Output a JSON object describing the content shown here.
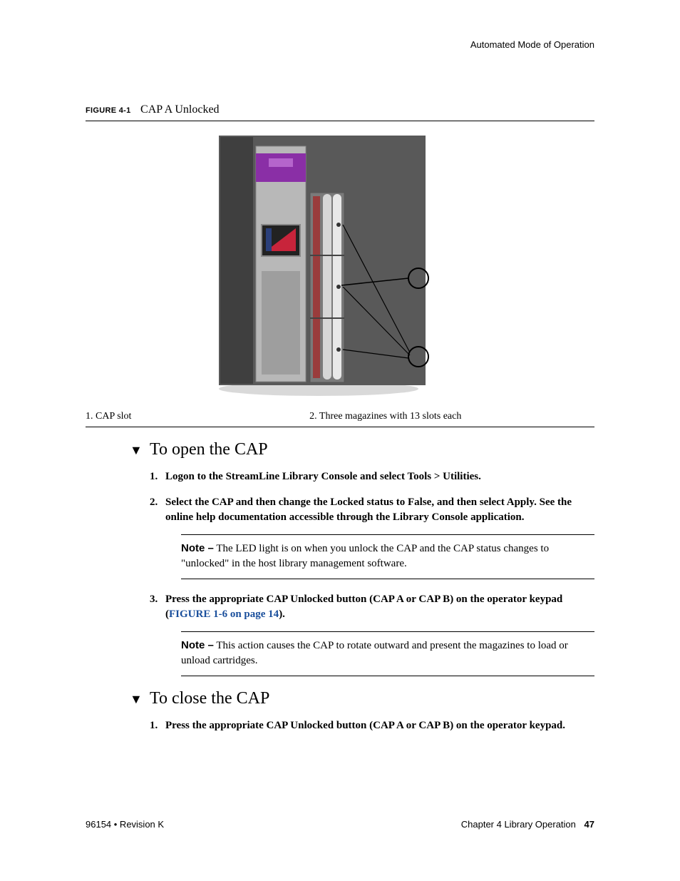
{
  "header": {
    "section": "Automated Mode of Operation"
  },
  "figure": {
    "label": "FIGURE 4-1",
    "title": "CAP A Unlocked",
    "legend": {
      "left": "1. CAP slot",
      "right": "2. Three magazines with 13 slots each"
    }
  },
  "sections": {
    "open": {
      "title": "To open the CAP",
      "steps": [
        "Logon to the StreamLine Library Console and select Tools > Utilities.",
        "Select the CAP and then change the Locked status to False, and then select Apply. See the online help documentation accessible through the Library Console application.",
        "Press the appropriate CAP Unlocked button (CAP A or CAP B) on the operator keypad ("
      ],
      "step3_link": "FIGURE 1-6 on page 14",
      "step3_suffix": ").",
      "note1": {
        "label": "Note –",
        "text": " The LED light is on when you unlock the CAP and the CAP status changes to \"unlocked\" in the host library management software."
      },
      "note2": {
        "label": "Note –",
        "text": " This action causes the CAP to rotate outward and present the magazines to load or unload cartridges."
      }
    },
    "close": {
      "title": "To close the CAP",
      "steps": [
        "Press the appropriate CAP Unlocked button (CAP A or CAP B) on the operator keypad."
      ]
    }
  },
  "footer": {
    "left": "96154 • Revision K",
    "right_chapter": "Chapter 4 Library Operation",
    "right_page": "47"
  }
}
